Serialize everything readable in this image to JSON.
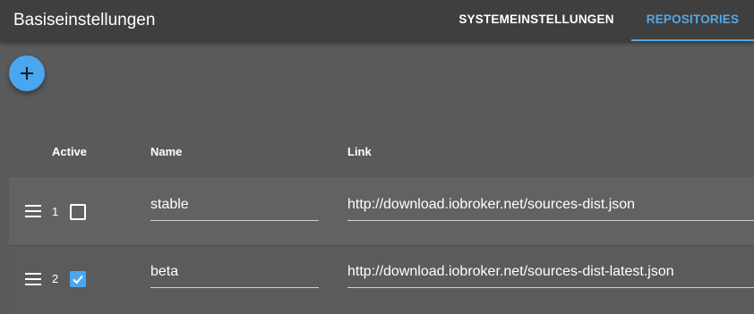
{
  "header": {
    "title": "Basiseinstellungen",
    "tabs": [
      {
        "label": "SYSTEMEINSTELLUNGEN",
        "active": false
      },
      {
        "label": "REPOSITORIES",
        "active": true
      }
    ]
  },
  "toolbar": {
    "add_icon": "plus-icon"
  },
  "table": {
    "columns": [
      "Active",
      "Name",
      "Link"
    ],
    "rows": [
      {
        "index": "1",
        "active": false,
        "name": "stable",
        "link": "http://download.iobroker.net/sources-dist.json"
      },
      {
        "index": "2",
        "active": true,
        "name": "beta",
        "link": "http://download.iobroker.net/sources-dist-latest.json"
      }
    ]
  },
  "colors": {
    "accent": "#4aa6ee",
    "tab_active": "#53a8e8",
    "appbar": "#3f3f3f",
    "background": "#5a5a5a"
  }
}
